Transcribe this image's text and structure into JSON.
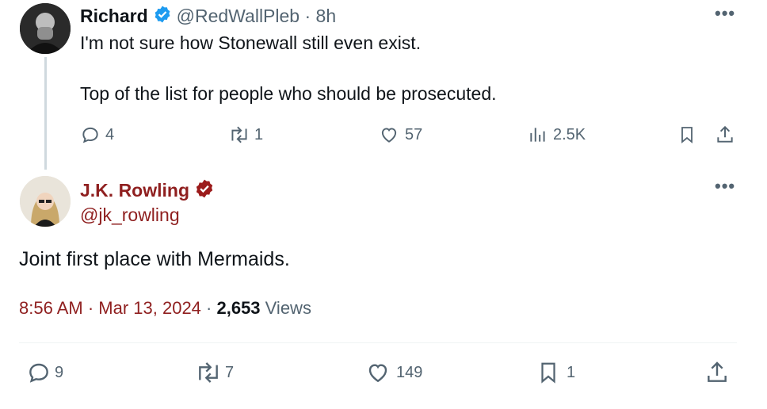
{
  "colors": {
    "verified_blue": "#1d9bf0",
    "verified_red": "#9c1b1b",
    "jk_red": "#8f1f1f",
    "gray": "#536471"
  },
  "reply_tweet": {
    "author_name": "Richard",
    "handle": "@RedWallPleb",
    "separator": " · ",
    "time": "8h",
    "line1": "I'm not sure how Stonewall still even exist.",
    "line2": "Top of the list for people who should be prosecuted.",
    "stats": {
      "replies": "4",
      "reposts": "1",
      "likes": "57",
      "views": "2.5K"
    },
    "icons": [
      "reply-icon",
      "repost-icon",
      "like-icon",
      "views-icon",
      "bookmark-icon",
      "share-icon"
    ]
  },
  "main_tweet": {
    "author_name": "J.K. Rowling",
    "handle": "@jk_rowling",
    "text": "Joint first place with Mermaids.",
    "time": "8:56 AM",
    "date_sep": " · ",
    "date": "Mar 13, 2024",
    "views_sep": " · ",
    "views_count": "2,653",
    "views_label": " Views",
    "stats": {
      "replies": "9",
      "reposts": "7",
      "likes": "149",
      "bookmarks": "1"
    },
    "icons": [
      "reply-icon",
      "repost-icon",
      "like-icon",
      "bookmark-icon",
      "share-icon"
    ]
  },
  "more_label": "•••"
}
